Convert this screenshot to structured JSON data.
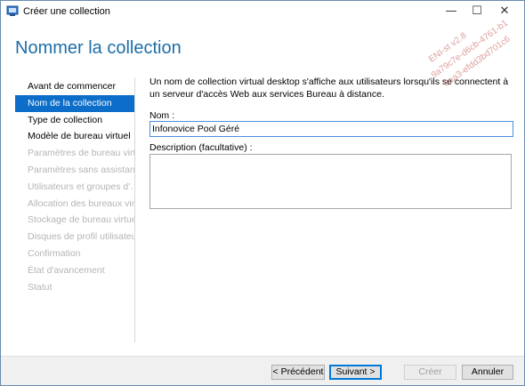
{
  "window": {
    "title": "Créer une collection"
  },
  "page": {
    "title": "Nommer la collection",
    "description": "Un nom de collection virtual desktop s'affiche aux utilisateurs lorsqu'ils se connectent à un serveur d'accès Web aux services Bureau à distance."
  },
  "nav": {
    "items": [
      {
        "label": "Avant de commencer",
        "state": "enabled"
      },
      {
        "label": "Nom de la collection",
        "state": "selected"
      },
      {
        "label": "Type de collection",
        "state": "enabled"
      },
      {
        "label": "Modèle de bureau virtuel",
        "state": "enabled"
      },
      {
        "label": "Paramètres de bureau virt…",
        "state": "disabled"
      },
      {
        "label": "Paramètres sans assistance",
        "state": "disabled"
      },
      {
        "label": "Utilisateurs et groupes d'…",
        "state": "disabled"
      },
      {
        "label": "Allocation des bureaux vir…",
        "state": "disabled"
      },
      {
        "label": "Stockage de bureau virtuel",
        "state": "disabled"
      },
      {
        "label": "Disques de profil utilisateur",
        "state": "disabled"
      },
      {
        "label": "Confirmation",
        "state": "disabled"
      },
      {
        "label": "État d'avancement",
        "state": "disabled"
      },
      {
        "label": "Statut",
        "state": "disabled"
      }
    ]
  },
  "form": {
    "name_label": "Nom :",
    "name_value": "Infonovice Pool Géré",
    "description_label": "Description (facultative) :",
    "description_value": ""
  },
  "buttons": {
    "previous": "< Précédent",
    "next": "Suivant >",
    "create": "Créer",
    "cancel": "Annuler"
  },
  "watermark": {
    "line1": "ENI-st v2.8",
    "line2": "9a79c7e-d6cb-4761-b1",
    "line3": "8aa3-efdd3bd701c6"
  },
  "colors": {
    "accent": "#0c6ec9",
    "title": "#1d6ea8",
    "disabled_text": "#b5b5b5"
  }
}
